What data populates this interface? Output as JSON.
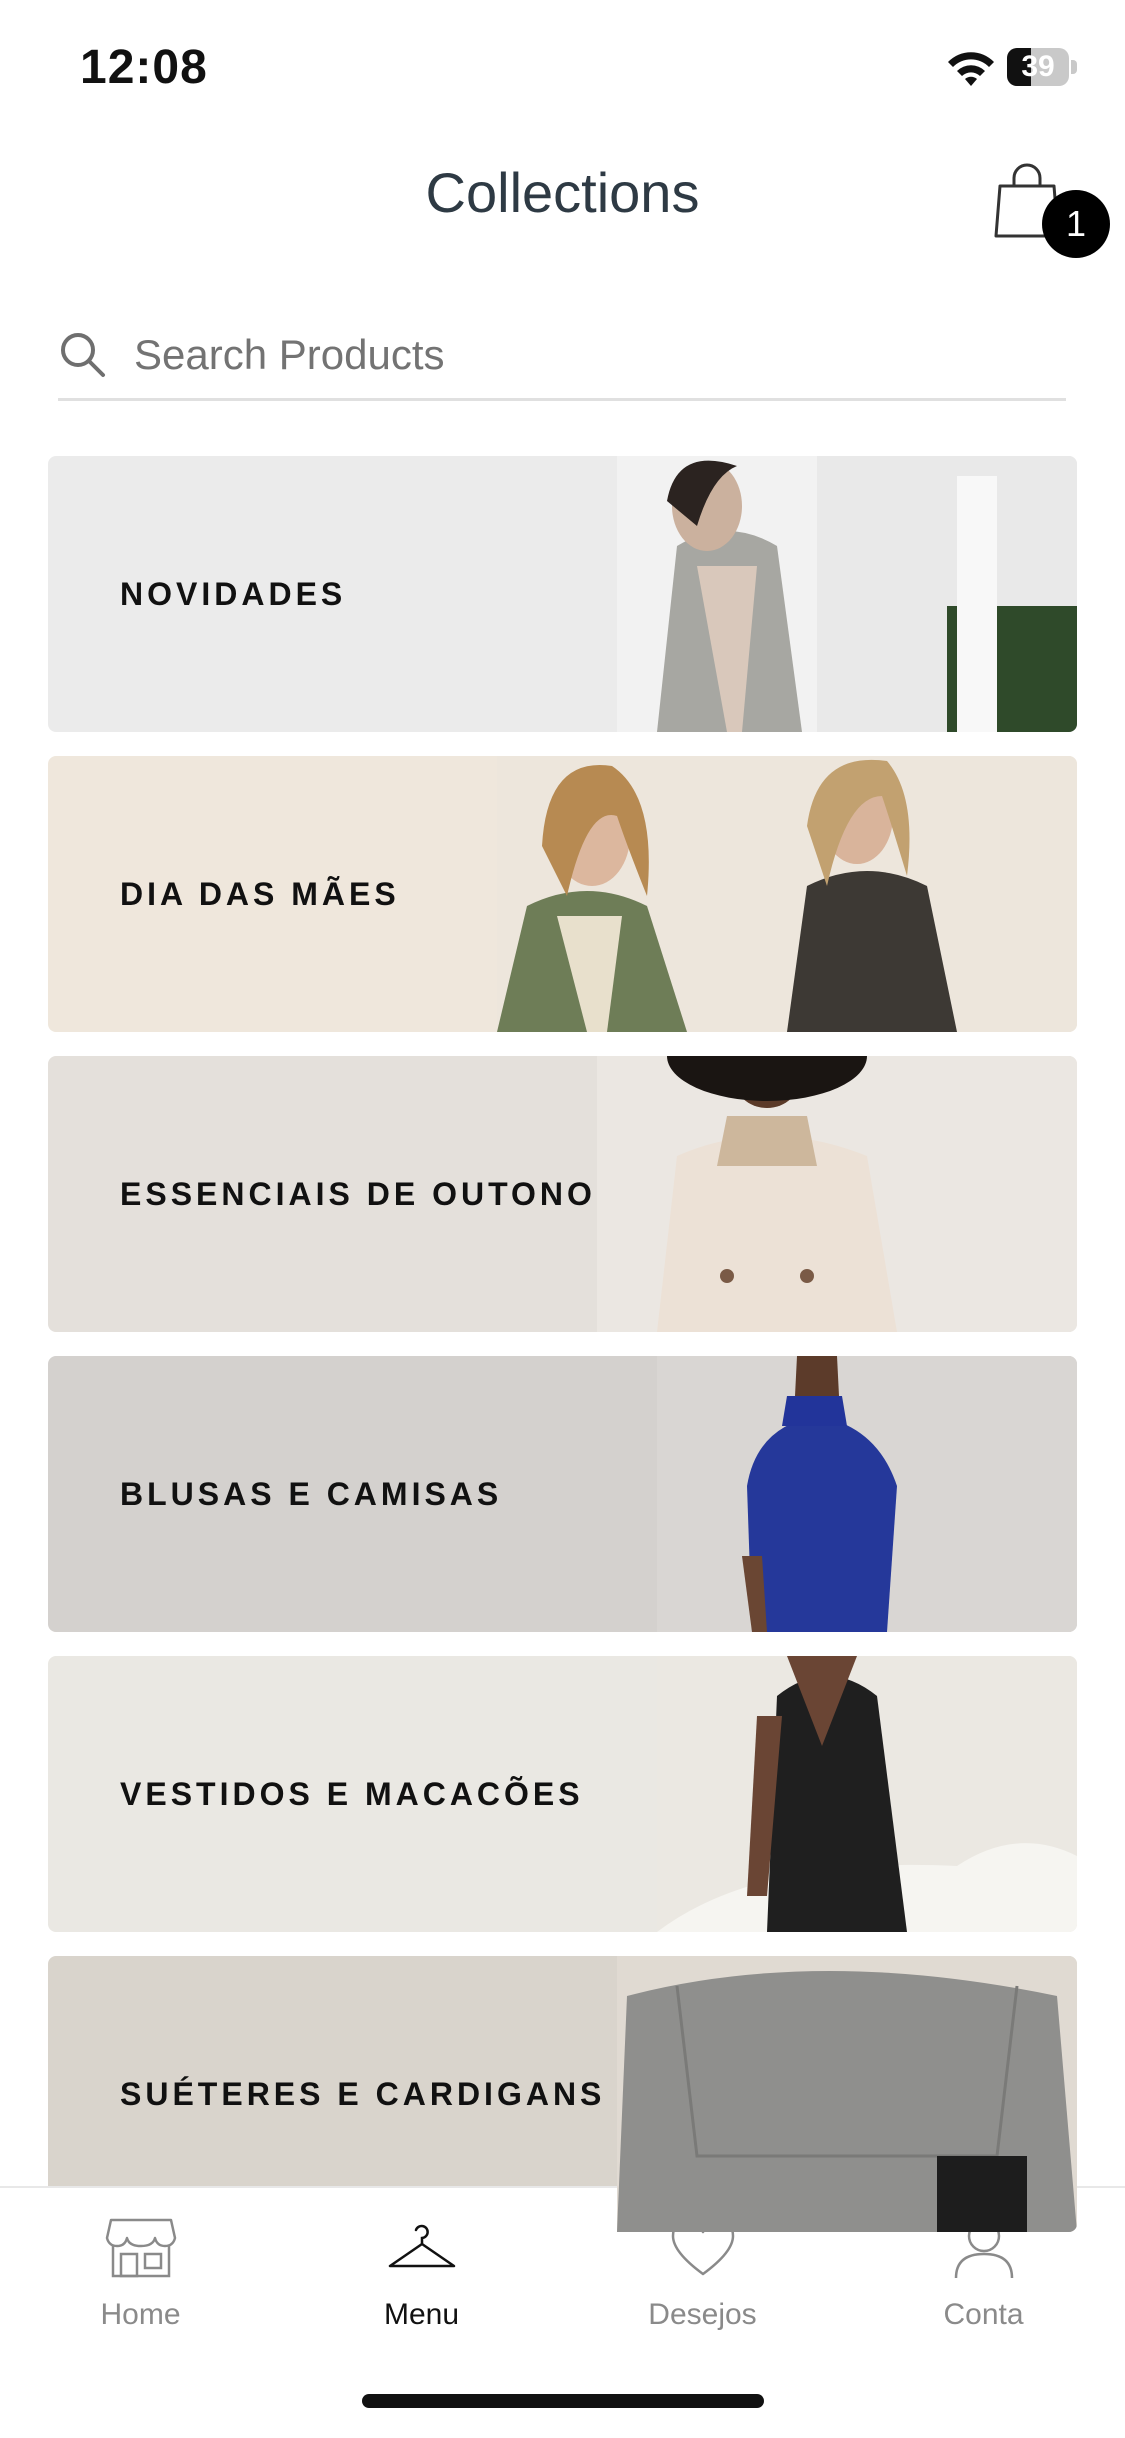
{
  "status_bar": {
    "time": "12:08",
    "battery_level": "39",
    "battery_fraction": 0.39
  },
  "header": {
    "title": "Collections",
    "cart_count": "1"
  },
  "search": {
    "placeholder": "Search Products",
    "value": ""
  },
  "collections": [
    {
      "label": "NOVIDADES",
      "bg": "#ebebeb"
    },
    {
      "label": "DIA DAS MÃES",
      "bg": "#efe7dc"
    },
    {
      "label": "ESSENCIAIS DE OUTONO",
      "bg": "#e4e0db"
    },
    {
      "label": "BLUSAS E CAMISAS",
      "bg": "#d4d1ce"
    },
    {
      "label": "VESTIDOS E MACACÕES",
      "bg": "#eae8e3"
    },
    {
      "label": "SUÉTERES E CARDIGANS",
      "bg": "#d9d4cc"
    }
  ],
  "tabs": [
    {
      "label": "Home",
      "icon": "storefront-icon",
      "active": false
    },
    {
      "label": "Menu",
      "icon": "hanger-icon",
      "active": true
    },
    {
      "label": "Desejos",
      "icon": "heart-icon",
      "active": false
    },
    {
      "label": "Conta",
      "icon": "person-icon",
      "active": false
    }
  ],
  "colors": {
    "text_dark": "#2e3a44",
    "badge": "#000000",
    "tab_inactive": "#8a8a8a",
    "tab_active": "#111111"
  }
}
